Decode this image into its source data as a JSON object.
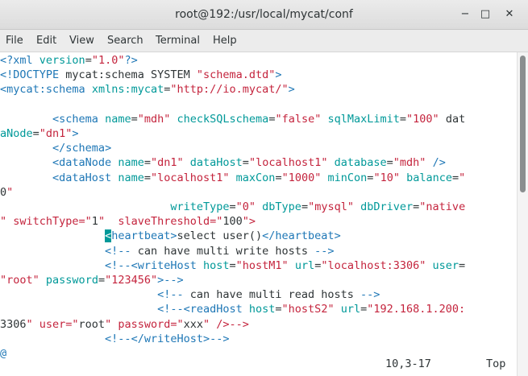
{
  "window": {
    "title": "root@192:/usr/local/mycat/conf",
    "minimize_glyph": "−",
    "maximize_glyph": "□",
    "close_glyph": "✕"
  },
  "menu": {
    "items": [
      "File",
      "Edit",
      "View",
      "Search",
      "Terminal",
      "Help"
    ]
  },
  "editor": {
    "lines": [
      "<?xml version=\"1.0\"?>",
      "<!DOCTYPE mycat:schema SYSTEM \"schema.dtd\">",
      "<mycat:schema xmlns:mycat=\"http://io.mycat/\">",
      "",
      "        <schema name=\"mdh\" checkSQLschema=\"false\" sqlMaxLimit=\"100\" dat",
      "aNode=\"dn1\">",
      "        </schema>",
      "        <dataNode name=\"dn1\" dataHost=\"localhost1\" database=\"mdh\" />",
      "        <dataHost name=\"localhost1\" maxCon=\"1000\" minCon=\"10\" balance=\"",
      "0\"",
      "                          writeType=\"0\" dbType=\"mysql\" dbDriver=\"native",
      "\" switchType=\"1\"  slaveThreshold=\"100\">",
      "                <heartbeat>select user()</heartbeat>",
      "                <!-- can have multi write hosts -->",
      "                <!--<writeHost host=\"hostM1\" url=\"localhost:3306\" user=",
      "\"root\" password=\"123456\">-->",
      "                        <!-- can have multi read hosts -->",
      "                        <!--<readHost host=\"hostS2\" url=\"192.168.1.200:",
      "3306\" user=\"root\" password=\"xxx\" />-->",
      "                <!--</writeHost>-->",
      "@"
    ],
    "status_position": "10,3-17",
    "status_scroll": "Top"
  },
  "colors": {
    "tag": "#1e77b6",
    "attr": "#009999",
    "string": "#c4243d",
    "text": "#2e3436",
    "cursor": "#009999"
  }
}
